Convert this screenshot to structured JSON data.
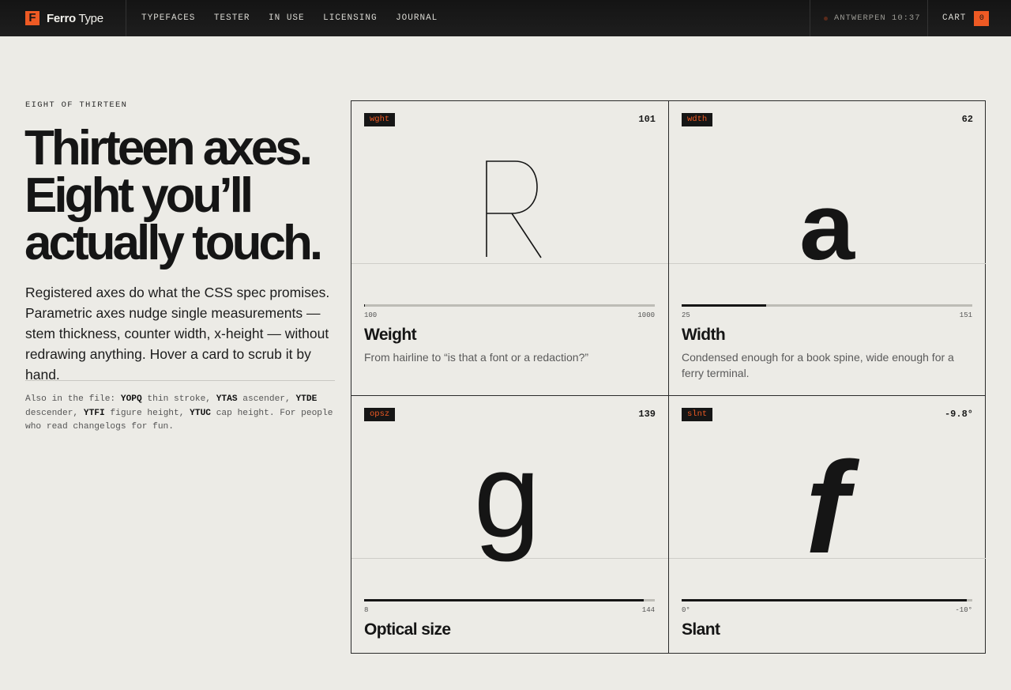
{
  "brand": {
    "mark": "F",
    "name_bold": "Ferro",
    "name_rest": " Type"
  },
  "nav": [
    "TYPEFACES",
    "TESTER",
    "IN USE",
    "LICENSING",
    "JOURNAL"
  ],
  "clock": {
    "city": "ANTWERPEN",
    "time": "10:37"
  },
  "cart": {
    "label": "CART",
    "count": "0"
  },
  "intro": {
    "eyebrow": "EIGHT OF THIRTEEN",
    "headline": [
      "Thirteen axes.",
      "Eight you’ll",
      "actually touch."
    ],
    "lede": "Registered axes do what the CSS spec promises. Parametric axes nudge single measurements — stem thickness, counter width, x-height — without redrawing anything. Hover a card to scrub it by hand.",
    "note": {
      "prefix": "Also in the file: ",
      "items": [
        {
          "code": "YOPQ",
          "text": " thin stroke, "
        },
        {
          "code": "YTAS",
          "text": " ascender, "
        },
        {
          "code": "YTDE",
          "text": " descender, "
        },
        {
          "code": "YTFI",
          "text": " figure height, "
        },
        {
          "code": "YTUC",
          "text": " cap height."
        }
      ],
      "suffix": " For people who read changelogs for fun."
    }
  },
  "cards": [
    {
      "tag": "wght",
      "value": "101",
      "glyph": "R",
      "min": "100",
      "max": "1000",
      "fill": 0.001,
      "name": "Weight",
      "desc": "From hairline to “is that a font or a redaction?”"
    },
    {
      "tag": "wdth",
      "value": "62",
      "glyph": "a",
      "min": "25",
      "max": "151",
      "fill": 0.29,
      "name": "Width",
      "desc": "Condensed enough for a book spine, wide enough for a ferry terminal."
    },
    {
      "tag": "opsz",
      "value": "139",
      "glyph": "g",
      "min": "8",
      "max": "144",
      "fill": 0.963,
      "name": "Optical size",
      "desc": ""
    },
    {
      "tag": "slnt",
      "value": "-9.8°",
      "glyph": "f",
      "min": "0°",
      "max": "-10°",
      "fill": 0.98,
      "name": "Slant",
      "desc": ""
    }
  ],
  "colors": {
    "accent": "#ee5a24",
    "ink": "#151515",
    "paper": "#ecebe6",
    "bar": "#1a1a1a"
  }
}
